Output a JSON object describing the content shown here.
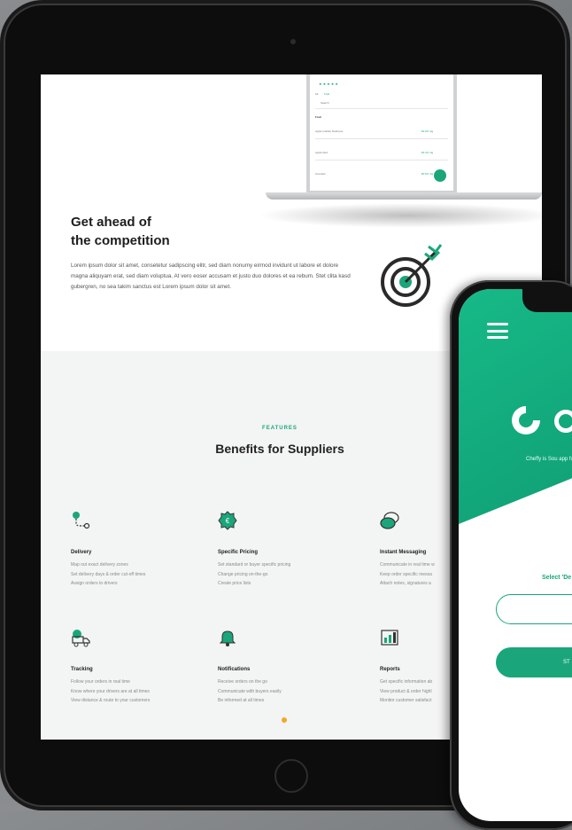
{
  "tablet": {
    "laptop_preview": {
      "stars": "★★★★★",
      "tabs": [
        "All",
        "Fruit"
      ],
      "search_placeholder": "Search",
      "section": "Fruit",
      "rows": [
        {
          "name": "Apple Golden Delicious",
          "price": "€2.00 / kg"
        },
        {
          "name": "Apple Red",
          "price": "€2.40 / kg"
        },
        {
          "name": "Avocado",
          "price": "€0.60 / kg"
        }
      ]
    },
    "hero": {
      "title_line1": "Get ahead of",
      "title_line2": "the competition",
      "paragraph": "Lorem ipsum dolor sit amet, consetetur sadipscing elitr, sed diam nonumy eirmod invidunt ut labore et dolore magna aliquyam erat, sed diam voluptua. At vero eoser accusam et justo duo dolores et ea rebum. Stet clita kasd gubergren, no sea takim sanctus est Lorem ipsum dolor sit amet."
    },
    "features": {
      "kicker": "FEATURES",
      "title": "Benefits for Suppliers",
      "items": [
        {
          "name": "Delivery",
          "lines": [
            "Map out exact delivery zones",
            "Set delivery days & order cut-off times",
            "Assign orders to drivers"
          ]
        },
        {
          "name": "Specific Pricing",
          "lines": [
            "Set standard or buyer specific pricing",
            "Change pricing on-the-go",
            "Create price lists"
          ]
        },
        {
          "name": "Instant Messaging",
          "lines": [
            "Communicate in real time w",
            "Keep order specific messa",
            "Attach notes, signatures a"
          ]
        },
        {
          "name": "Tracking",
          "lines": [
            "Follow your orders in real time",
            "Know where your drivers are at all times",
            "View distance & route to your customers"
          ]
        },
        {
          "name": "Notifications",
          "lines": [
            "Receive orders on the go",
            "Communicate with buyers easily",
            "Be informed at all times"
          ]
        },
        {
          "name": "Reports",
          "lines": [
            "Get specific information ab",
            "View product & order highl",
            "Monitor customer satisfact"
          ]
        }
      ]
    }
  },
  "phone": {
    "tagline": "Cheffy is Sou app for the",
    "select_label": "Select 'De",
    "start_label": "ST"
  },
  "colors": {
    "accent": "#1aa67a",
    "indicator": "#f5a623"
  }
}
